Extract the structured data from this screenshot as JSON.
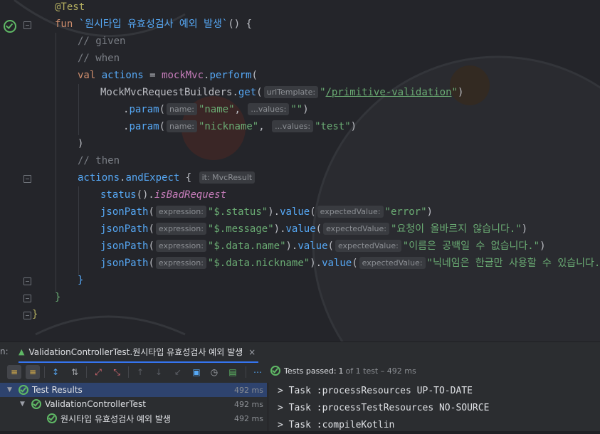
{
  "editor": {
    "lines": [
      {
        "indent": 1,
        "tokens": [
          {
            "t": "@Test",
            "c": "anno"
          }
        ]
      },
      {
        "indent": 1,
        "tokens": [
          {
            "t": "fun ",
            "c": "kw"
          },
          {
            "t": "`원시타입 유효성검사 예외 발생`",
            "c": "fn"
          },
          {
            "t": "() {",
            "c": "plain"
          }
        ]
      },
      {
        "indent": 2,
        "tokens": [
          {
            "t": "// given",
            "c": "cmt"
          }
        ]
      },
      {
        "indent": 2,
        "tokens": [
          {
            "t": "// when",
            "c": "cmt"
          }
        ]
      },
      {
        "indent": 2,
        "tokens": [
          {
            "t": "val ",
            "c": "kw"
          },
          {
            "t": "actions",
            "c": "fn"
          },
          {
            "t": " = ",
            "c": "plain"
          },
          {
            "t": "mockMvc",
            "c": "var"
          },
          {
            "t": ".",
            "c": "plain"
          },
          {
            "t": "perform",
            "c": "fn"
          },
          {
            "t": "(",
            "c": "plain"
          }
        ]
      },
      {
        "indent": 3,
        "tokens": [
          {
            "t": "MockMvcRequestBuilders",
            "c": "plain"
          },
          {
            "t": ".",
            "c": "plain"
          },
          {
            "t": "get",
            "c": "fn"
          },
          {
            "t": "(",
            "c": "plain"
          },
          {
            "hint": "urlTemplate:"
          },
          {
            "t": "\"",
            "c": "str"
          },
          {
            "t": "/primitive-validation",
            "c": "str ul"
          },
          {
            "t": "\"",
            "c": "str"
          },
          {
            "t": ")",
            "c": "plain"
          }
        ]
      },
      {
        "indent": 4,
        "tokens": [
          {
            "t": ".",
            "c": "plain"
          },
          {
            "t": "param",
            "c": "fn"
          },
          {
            "t": "(",
            "c": "plain"
          },
          {
            "hint": "name:"
          },
          {
            "t": "\"name\"",
            "c": "str"
          },
          {
            "t": ", ",
            "c": "plain"
          },
          {
            "hint": "...values:"
          },
          {
            "t": "\"\"",
            "c": "str"
          },
          {
            "t": ")",
            "c": "plain"
          }
        ]
      },
      {
        "indent": 4,
        "tokens": [
          {
            "t": ".",
            "c": "plain"
          },
          {
            "t": "param",
            "c": "fn"
          },
          {
            "t": "(",
            "c": "plain"
          },
          {
            "hint": "name:"
          },
          {
            "t": "\"nickname\"",
            "c": "str"
          },
          {
            "t": ", ",
            "c": "plain"
          },
          {
            "hint": "...values:"
          },
          {
            "t": "\"test\"",
            "c": "str"
          },
          {
            "t": ")",
            "c": "plain"
          }
        ]
      },
      {
        "indent": 2,
        "tokens": [
          {
            "t": ")",
            "c": "plain"
          }
        ]
      },
      {
        "indent": 2,
        "tokens": [
          {
            "t": "// then",
            "c": "cmt"
          }
        ]
      },
      {
        "indent": 2,
        "tokens": [
          {
            "t": "actions",
            "c": "fn"
          },
          {
            "t": ".",
            "c": "plain"
          },
          {
            "t": "andExpect",
            "c": "fn"
          },
          {
            "t": " { ",
            "c": "plain"
          },
          {
            "hint": "it: MvcResult"
          }
        ]
      },
      {
        "indent": 3,
        "tokens": [
          {
            "t": "status",
            "c": "fn"
          },
          {
            "t": "().",
            "c": "plain"
          },
          {
            "t": "isBadRequest",
            "c": "var it"
          }
        ]
      },
      {
        "indent": 3,
        "tokens": [
          {
            "t": "jsonPath",
            "c": "fn"
          },
          {
            "t": "(",
            "c": "plain"
          },
          {
            "hint": "expression:"
          },
          {
            "t": "\"$.status\"",
            "c": "str"
          },
          {
            "t": ").",
            "c": "plain"
          },
          {
            "t": "value",
            "c": "fn"
          },
          {
            "t": "(",
            "c": "plain"
          },
          {
            "hint": "expectedValue:"
          },
          {
            "t": "\"error\"",
            "c": "str"
          },
          {
            "t": ")",
            "c": "plain"
          }
        ]
      },
      {
        "indent": 3,
        "tokens": [
          {
            "t": "jsonPath",
            "c": "fn"
          },
          {
            "t": "(",
            "c": "plain"
          },
          {
            "hint": "expression:"
          },
          {
            "t": "\"$.message\"",
            "c": "str"
          },
          {
            "t": ").",
            "c": "plain"
          },
          {
            "t": "value",
            "c": "fn"
          },
          {
            "t": "(",
            "c": "plain"
          },
          {
            "hint": "expectedValue:"
          },
          {
            "t": "\"요청이 올바르지 않습니다.\"",
            "c": "str"
          },
          {
            "t": ")",
            "c": "plain"
          }
        ]
      },
      {
        "indent": 3,
        "tokens": [
          {
            "t": "jsonPath",
            "c": "fn"
          },
          {
            "t": "(",
            "c": "plain"
          },
          {
            "hint": "expression:"
          },
          {
            "t": "\"$.data.name\"",
            "c": "str"
          },
          {
            "t": ").",
            "c": "plain"
          },
          {
            "t": "value",
            "c": "fn"
          },
          {
            "t": "(",
            "c": "plain"
          },
          {
            "hint": "expectedValue:"
          },
          {
            "t": "\"이름은 공백일 수 없습니다.\"",
            "c": "str"
          },
          {
            "t": ")",
            "c": "plain"
          }
        ]
      },
      {
        "indent": 3,
        "tokens": [
          {
            "t": "jsonPath",
            "c": "fn"
          },
          {
            "t": "(",
            "c": "plain"
          },
          {
            "hint": "expression:"
          },
          {
            "t": "\"$.data.nickname\"",
            "c": "str"
          },
          {
            "t": ").",
            "c": "plain"
          },
          {
            "t": "value",
            "c": "fn"
          },
          {
            "t": "(",
            "c": "plain"
          },
          {
            "hint": "expectedValue:"
          },
          {
            "t": "\"닉네임은 한글만 사용할 수 있습니다.\"",
            "c": "str"
          },
          {
            "t": ")",
            "c": "plain"
          }
        ]
      },
      {
        "indent": 2,
        "tokens": [
          {
            "t": "}",
            "c": "fn"
          }
        ]
      },
      {
        "indent": 1,
        "tokens": [
          {
            "t": "}",
            "c": "str"
          }
        ]
      },
      {
        "indent": 0,
        "tokens": [
          {
            "t": "}",
            "c": "anno"
          }
        ]
      }
    ]
  },
  "run_panel": {
    "label": "n:",
    "tab_title": "ValidationControllerTest.원시타입 유효성검사 예외 발생",
    "close_glyph": "×",
    "status": {
      "passed": "Tests passed:",
      "count": "1",
      "detail": "of 1 test – 492 ms"
    },
    "tree": [
      {
        "label": "Test Results",
        "time": "492 ms",
        "level": 0,
        "selected": true
      },
      {
        "label": "ValidationControllerTest",
        "time": "492 ms",
        "level": 1,
        "selected": false
      },
      {
        "label": "원시타입 유효성검사 예외 발생",
        "time": "492 ms",
        "level": 2,
        "selected": false
      }
    ],
    "console": [
      "> Task :processResources UP-TO-DATE",
      "> Task :processTestResources NO-SOURCE",
      "> Task :compileKotlin"
    ]
  },
  "colors": {
    "accent": "#3574f0",
    "passed": "#5fb865",
    "selection": "#2e436e"
  }
}
